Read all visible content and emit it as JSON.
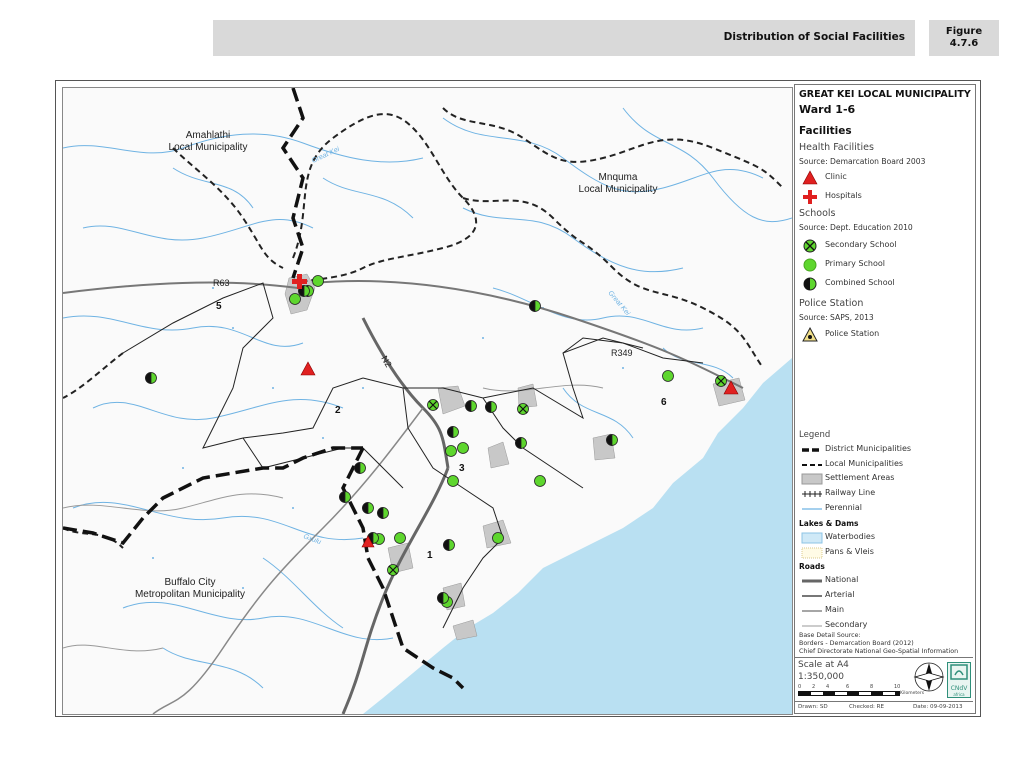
{
  "header": {
    "title": "Distribution of Social Facilities",
    "figure_label": "Figure",
    "figure_number": "4.7.6"
  },
  "map": {
    "place_labels": [
      {
        "line1": "Amahlathi",
        "line2": "Local Municipality"
      },
      {
        "line1": "Mnquma",
        "line2": "Local Municipality"
      },
      {
        "line1": "Buffalo City",
        "line2": "Metropolitan Municipality"
      }
    ],
    "ward_numbers": [
      "1",
      "2",
      "3",
      "5",
      "6"
    ],
    "road_labels": [
      "R63",
      "N2",
      "R349"
    ],
    "river_labels": [
      "Great Kei",
      "Great Kei",
      "Gxulu"
    ],
    "sea_color": "#b9e0f2",
    "river_color": "#6fb3e3"
  },
  "legend": {
    "title_line1": "GREAT KEI LOCAL MUNICIPALITY",
    "title_line2": "Ward 1-6",
    "facilities_heading": "Facilities",
    "health_heading": "Health Facilities",
    "health_source": "Source: Demarcation Board 2003",
    "clinic": "Clinic",
    "hospitals": "Hospitals",
    "schools_heading": "Schools",
    "schools_source": "Source: Dept. Education 2010",
    "secondary": "Secondary School",
    "primary": "Primary School",
    "combined": "Combined School",
    "police_heading": "Police Station",
    "police_source": "Source: SAPS, 2013",
    "police": "Police Station",
    "legend_heading": "Legend",
    "district": "District Municipalities",
    "local": "Local Municipalities",
    "settlement": "Settlement Areas",
    "railway": "Railway Line",
    "perennial": "Perennial",
    "lakes_heading": "Lakes & Dams",
    "waterbodies": "Waterbodies",
    "pans": "Pans & Vleis",
    "roads_heading": "Roads",
    "national": "National",
    "arterial": "Arterial",
    "main": "Main",
    "secondary_road": "Secondary",
    "base_source_1": "Base Detail Source:",
    "base_source_2": "Borders - Demarcation Board (2012)",
    "base_source_3": "Chief Directorate National Geo-Spatial Information",
    "scale_at": "Scale at A4",
    "scale_ratio": "1:350,000",
    "scale_ticks": [
      "0",
      "2",
      "4",
      "6",
      "8",
      "10"
    ],
    "scale_unit": "Kilometers",
    "drawn": "Drawn: SD",
    "checked": "Checked: RE",
    "date": "Date: 09-09-2013",
    "logo_text": "CNdV",
    "logo_sub": "africa"
  }
}
